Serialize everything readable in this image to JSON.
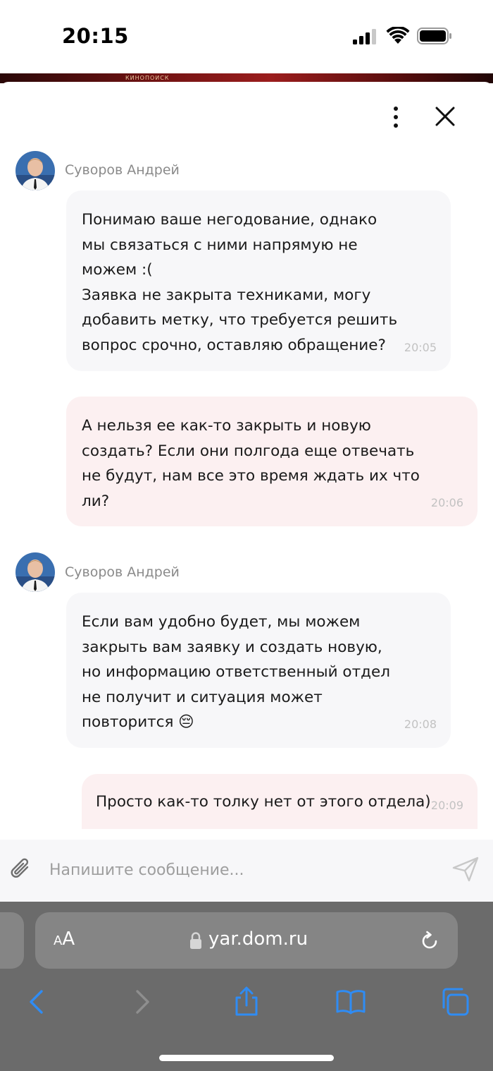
{
  "status_bar": {
    "time": "20:15"
  },
  "backdrop": {
    "logo_text": "КИНОПОИСК"
  },
  "chat": {
    "messages": [
      {
        "direction": "in",
        "sender": "Суворов Андрей",
        "text": "Понимаю ваше негодование, однако\nмы связаться с ними напрямую не\nможем :(\nЗаявка не закрыта техниками, могу\nдобавить метку, что требуется решить\nвопрос срочно, оставляю обращение?",
        "time": "20:05"
      },
      {
        "direction": "out",
        "text": "А нельзя ее как-то закрыть и новую\nсоздать? Если они полгода еще отвечать\nне будут, нам все это время ждать их что\nли?",
        "time": "20:06"
      },
      {
        "direction": "in",
        "sender": "Суворов Андрей",
        "text": "Если вам удобно будет, мы можем\nзакрыть вам заявку и создать новую,\nно информацию ответственный отдел\nне получит и ситуация может\nповторится 😔",
        "time": "20:08"
      },
      {
        "direction": "out",
        "text": "Просто как-то толку нет от этого отдела)",
        "time": "20:09"
      }
    ]
  },
  "composer": {
    "placeholder": "Напишите сообщение..."
  },
  "browser": {
    "aa_label_small": "A",
    "aa_label_large": "A",
    "url": "yar.dom.ru"
  },
  "colors": {
    "accent_blue": "#2f8cf4",
    "incoming_bubble": "#f7f7f9",
    "outgoing_bubble": "#fcf0f1",
    "browser_chrome": "#6b6b6b"
  },
  "icons": [
    "signal-icon",
    "wifi-icon",
    "battery-icon",
    "more-icon",
    "close-icon",
    "avatar",
    "paperclip-icon",
    "send-icon",
    "lock-icon",
    "reload-icon",
    "back-icon",
    "forward-icon",
    "share-icon",
    "bookmarks-icon",
    "tabs-icon"
  ]
}
